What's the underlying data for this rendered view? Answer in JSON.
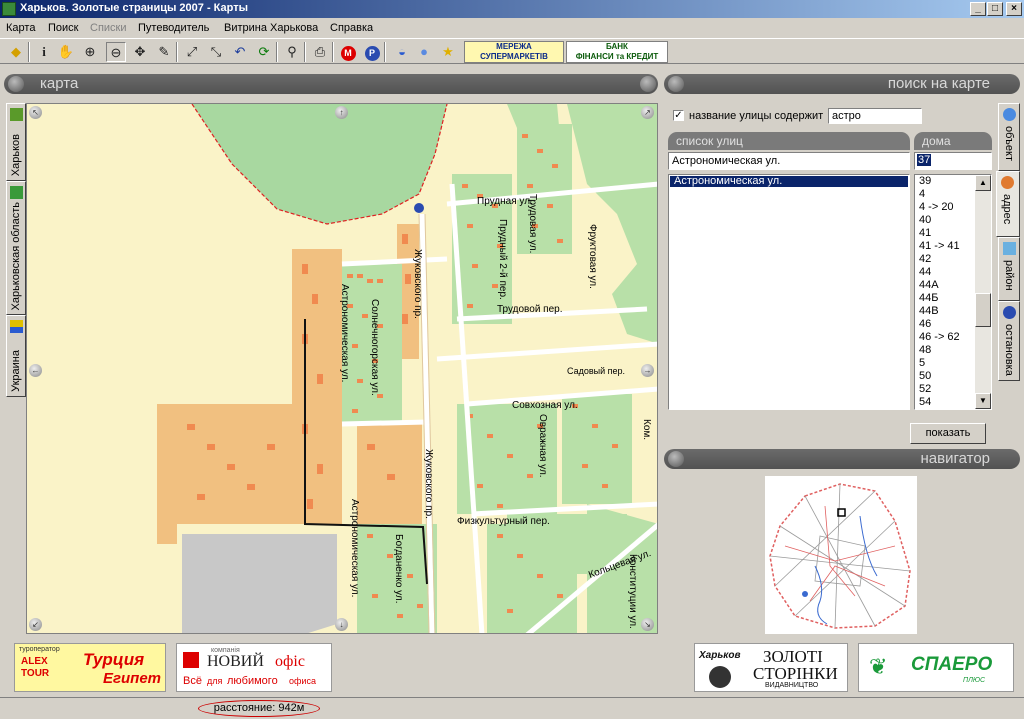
{
  "window": {
    "title": "Харьков. Золотые страницы 2007 - Карты",
    "buttons": {
      "minimize": "_",
      "maximize": "□",
      "close": "×"
    }
  },
  "menu": [
    "Карта",
    "Поиск",
    "Списки",
    "Путеводитель",
    "Витрина Харькова",
    "Справка"
  ],
  "toolbar": {
    "ad1_line1": "МЕРЕЖА",
    "ad1_line2": "СУПЕРМАРКЕТІВ",
    "ad2_line1": "БАНК",
    "ad2_line2": "ФІНАНСИ та КРЕДИТ"
  },
  "map_panel": {
    "header": "карта"
  },
  "left_tabs": [
    "Харьков",
    "Харьковская область",
    "Украина"
  ],
  "map_labels": {
    "astronomicheskaya_1": "Астрономическая ул.",
    "astronomicheskaya_2": "Астрономическая ул.",
    "solnechnaya": "Солнечногорская ул.",
    "zhukovskogo_1": "Жуковского пр.",
    "zhukovskogo_2": "Жуковского пр.",
    "prudnaya": "Прудная ул.",
    "trudovoy": "Трудовой пер.",
    "prudnaya_per": "Прудный 2-й пер.",
    "trudovaya": "Трудовая ул.",
    "sovkhoznaya": "Совхозная ул.",
    "fizkultur": "Физкультурный пер.",
    "koltsevaya": "Кольцевая ул.",
    "sadovy": "Садовый пер.",
    "fruktovaya": "Фруктовая ул.",
    "ovrazhnaya": "Овражная ул.",
    "bogdanenka": "Богданенко ул.",
    "kommunalnaya": "Ком.",
    "konstitutsii": "Конституции ул."
  },
  "search_panel": {
    "header": "поиск на карте",
    "checkbox_label": "название улицы содержит",
    "checkbox_checked": true,
    "street_query": "астро",
    "streets_header": "список улиц",
    "houses_header": "дома",
    "selected_street": "Астрономическая ул.",
    "streets": [
      "Астрономическая ул."
    ],
    "house_input": "37",
    "houses": [
      "39",
      "4",
      "4 -> 20",
      "40",
      "41",
      "41 -> 41",
      "42",
      "44",
      "44А",
      "44Б",
      "44В",
      "46",
      "46 -> 62",
      "48",
      "5",
      "50",
      "52",
      "54"
    ],
    "show_button": "показать"
  },
  "right_tabs": [
    "объект",
    "адрес",
    "район",
    "остановка"
  ],
  "navigator": {
    "header": "навигатор"
  },
  "ads": {
    "ad1_title": "Турция",
    "ad1_sub": "Египет",
    "ad1_brand_top": "туроператор",
    "ad1_brand": "ALEX TOUR",
    "ad2_small": "компанія",
    "ad2_title_a": "НОВИЙ",
    "ad2_title_b": "офіс",
    "ad2_sub_a": "Всё",
    "ad2_sub_b": "для",
    "ad2_sub_c": "любимого",
    "ad2_sub_d": "офиса",
    "ad3_city": "Харьков",
    "ad3_line1": "ЗОЛОТІ",
    "ad3_line2": "СТОРІНКИ",
    "ad3_line3": "ВИДАВНИЦТВО",
    "ad4_title": "СПАЕРО",
    "ad4_sub": "ПЛЮС"
  },
  "status": {
    "distance": "расстояние: 942м"
  }
}
